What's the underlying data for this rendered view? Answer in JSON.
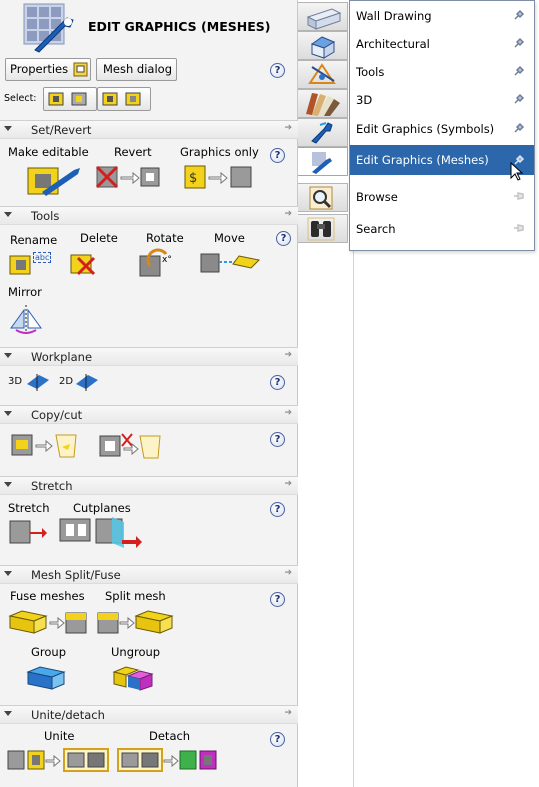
{
  "header": {
    "title": "EDIT GRAPHICS (MESHES)",
    "properties_label": "Properties",
    "mesh_dialog_label": "Mesh dialog",
    "select_label": "Select:"
  },
  "help_glyph": "?",
  "sections": {
    "set_revert": {
      "title": "Set/Revert",
      "make_editable": "Make editable",
      "revert": "Revert",
      "graphics_only": "Graphics only"
    },
    "tools": {
      "title": "Tools",
      "rename": "Rename",
      "rename_tag": "abc",
      "delete": "Delete",
      "rotate": "Rotate",
      "move": "Move",
      "mirror": "Mirror"
    },
    "workplane": {
      "title": "Workplane",
      "mode_3d": "3D",
      "mode_2d": "2D"
    },
    "copy_cut": {
      "title": "Copy/cut"
    },
    "stretch": {
      "title": "Stretch",
      "stretch": "Stretch",
      "cutplanes": "Cutplanes"
    },
    "mesh_split_fuse": {
      "title": "Mesh Split/Fuse",
      "fuse": "Fuse meshes",
      "split": "Split mesh",
      "group": "Group",
      "ungroup": "Ungroup"
    },
    "unite_detach": {
      "title": "Unite/detach",
      "unite": "Unite",
      "detach": "Detach"
    }
  },
  "menu": {
    "items": [
      {
        "label": "Wall Drawing"
      },
      {
        "label": "Architectural"
      },
      {
        "label": "Tools"
      },
      {
        "label": "3D"
      },
      {
        "label": "Edit Graphics (Symbols)"
      },
      {
        "label": "Edit Graphics (Meshes)"
      },
      {
        "label": "Browse"
      },
      {
        "label": "Search"
      }
    ],
    "selected_index": 5
  },
  "colors": {
    "selected": "#2b67aa",
    "accent_yellow": "#f2d21b",
    "accent_blue": "#2a72c8",
    "accent_red": "#d41f1f"
  }
}
